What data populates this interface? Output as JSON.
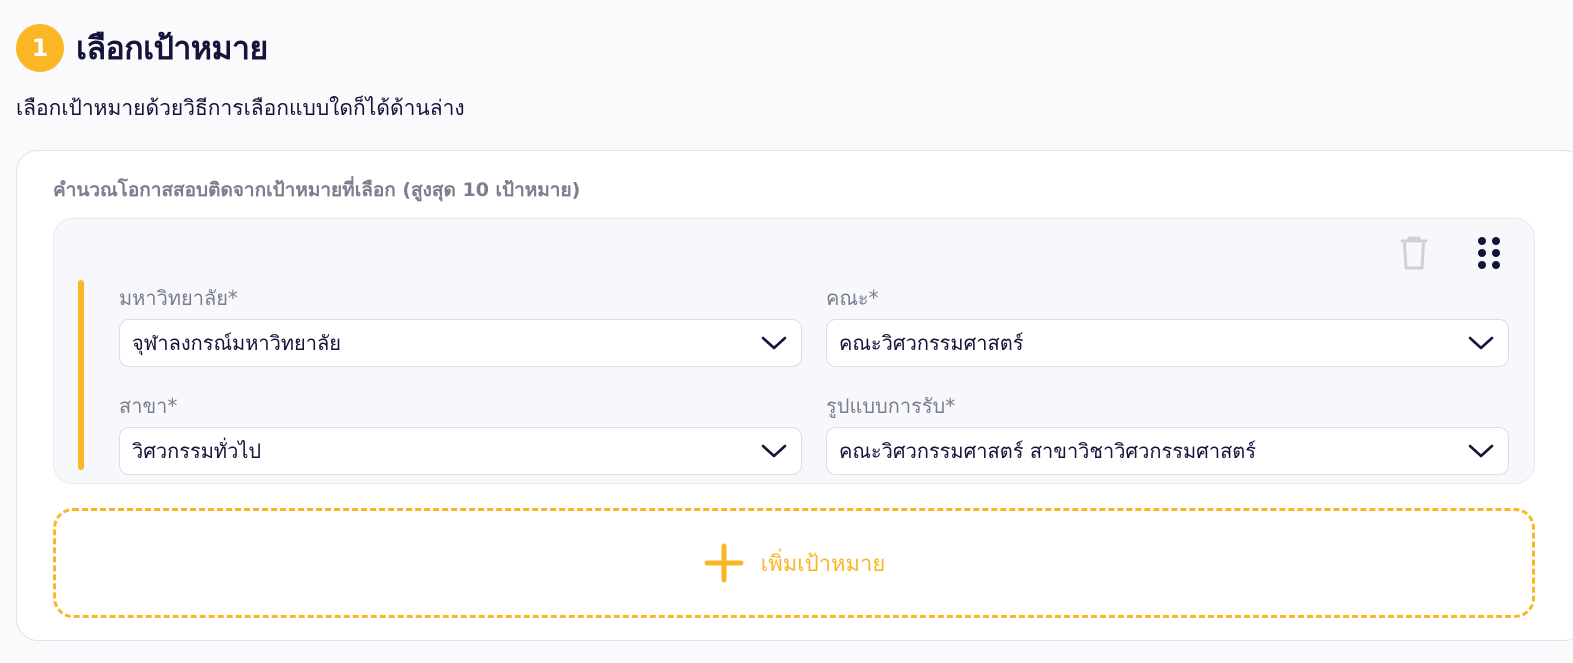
{
  "step": {
    "number": "1",
    "title": "เลือกเป้าหมาย",
    "subtitle": "เลือกเป้าหมายด้วยวิธีการเลือกแบบใดก็ได้ด้านล่าง"
  },
  "panel": {
    "caption": "คำนวณโอกาสสอบติดจากเป้าหมายที่เลือก (สูงสุด 10 เป้าหมาย)"
  },
  "target": {
    "icons": {
      "delete": "trash-icon",
      "drag": "drag-handle-icon",
      "dropdown": "chevron-down-icon"
    },
    "fields": [
      {
        "label": "มหาวิทยาลัย*",
        "value": "จุฬาลงกรณ์มหาวิทยาลัย"
      },
      {
        "label": "คณะ*",
        "value": "คณะวิศวกรรมศาสตร์"
      },
      {
        "label": "สาขา*",
        "value": "วิศวกรรมทั่วไป"
      },
      {
        "label": "รูปแบบการรับ*",
        "value": "คณะวิศวกรรมศาสตร์ สาขาวิชาวิศวกรรมศาสตร์"
      }
    ]
  },
  "add_button": {
    "label": "เพิ่มเป้าหมาย",
    "icon": "plus-icon"
  },
  "colors": {
    "accent": "#fbb626",
    "text": "#14143a",
    "muted": "#7c7d8e",
    "background": "#fafafc"
  }
}
